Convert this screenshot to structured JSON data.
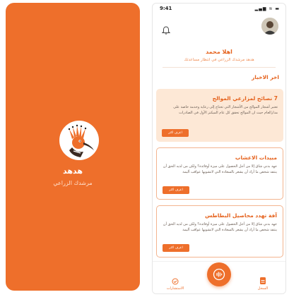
{
  "splash": {
    "app_name": "هدهد",
    "tagline": "مرشدك الزراعي"
  },
  "status_bar": {
    "time": "9:41",
    "icons": "▂▄▆ ≋ ▬"
  },
  "header": {
    "greeting": "اهلا محمد",
    "subtitle": "هدهد مرشدك الزراعي في انتظار مساعدتك"
  },
  "news": {
    "section_title": "اخر الاخبار",
    "items": [
      {
        "title": "7 نصائح لمزارعي الموالح",
        "body": "تعتبر أشجار الموالح من الأشجار التي تحتاج إلى رعاية وخدمة خاصة على مدارالعام حيث ان الموالح تحقق كل عام الميكنز الأول في الصادرات",
        "button": "اعرف اكثر"
      },
      {
        "title": "مبيدات الاعشاب",
        "body": "جهد بدني شاق إلا من أجل الحصول على ميزة أوفائدة؟ ولكن من لديه الحق أن ينتقد شخص ما أراد أن يشعر بالسعادة التي لاتشوبها عواقب أليمة",
        "button": "اعرف اكثر"
      },
      {
        "title": "آفة تهدد محاصيل البطاطس",
        "body": "جهد بدني شاق إلا من أجل الحصول على ميزة أوفائدة؟ ولكن من لديه الحق أن ينتقد شخص ما أراد أن يشعر بالسعادة التي لاتشوبها عواقب أليمة",
        "button": "اعرف اكثر"
      }
    ]
  },
  "tabbar": {
    "left_label": "الاستشارات",
    "right_label": "السجل"
  },
  "colors": {
    "brand_orange": "#ee6f2b",
    "card_tint": "#fde8d6"
  }
}
